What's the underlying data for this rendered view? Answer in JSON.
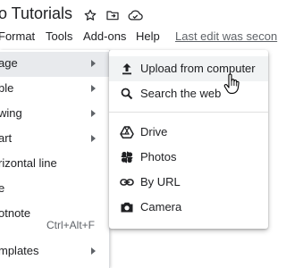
{
  "titlebar": {
    "doc_title": "o Tutorials",
    "icons": [
      "star-icon",
      "move-to-folder-icon",
      "cloud-status-icon"
    ]
  },
  "menubar": {
    "items": [
      "Format",
      "Tools",
      "Add-ons",
      "Help"
    ],
    "last_edit": "Last edit was secon"
  },
  "insert_menu": {
    "items": [
      {
        "label": "age",
        "has_submenu": true,
        "active": true
      },
      {
        "label": "ble",
        "has_submenu": true
      },
      {
        "label": "wing",
        "has_submenu": true
      },
      {
        "label": "art",
        "has_submenu": true
      },
      {
        "label": "rizontal line",
        "has_submenu": false
      },
      {
        "label": "e",
        "has_submenu": false
      },
      {
        "label": "otnote",
        "has_submenu": false,
        "shortcut": "Ctrl+Alt+F"
      },
      {
        "label": "mplates",
        "has_submenu": true
      }
    ]
  },
  "image_submenu": {
    "items": [
      {
        "label": "Upload from computer",
        "icon": "upload-icon",
        "hovered": true
      },
      {
        "label": "Search the web",
        "icon": "search-icon"
      },
      {
        "label": "Drive",
        "icon": "drive-icon"
      },
      {
        "label": "Photos",
        "icon": "photos-icon"
      },
      {
        "label": "By URL",
        "icon": "link-icon"
      },
      {
        "label": "Camera",
        "icon": "camera-icon"
      }
    ]
  },
  "colors": {
    "text": "#202124",
    "icon": "#5f6368",
    "hover": "#f1f3f4",
    "active": "#e8eaed"
  }
}
